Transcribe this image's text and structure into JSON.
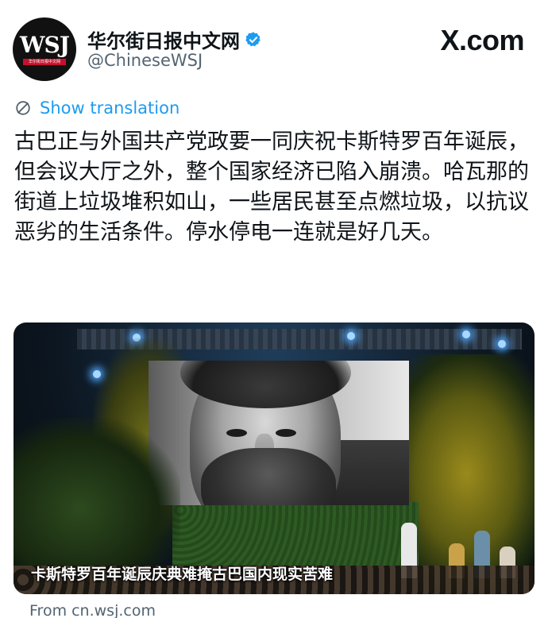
{
  "account": {
    "display_name": "华尔街日报中文网",
    "handle": "@ChineseWSJ",
    "avatar_text": "WSJ",
    "avatar_subtext": "华尔街日报中文网",
    "verified_color": "#1d9bf0"
  },
  "brand": {
    "site": "X.com"
  },
  "translation": {
    "label": "Show translation",
    "icon": "globe-icon"
  },
  "tweet": {
    "text": "古巴正与外国共产党政要一同庆祝卡斯特罗百年诞辰，但会议大厅之外，整个国家经济已陷入崩溃。哈瓦那的街道上垃圾堆积如山，一些居民甚至点燃垃圾，以抗议恶劣的生活条件。停水停电一连就是好几天。"
  },
  "media": {
    "caption": "卡斯特罗百年诞辰庆典难掩古巴国内现实苦难"
  },
  "link": {
    "source": "From cn.wsj.com"
  },
  "colors": {
    "accent": "#1d9bf0",
    "text": "#0f1419",
    "muted": "#536471"
  }
}
